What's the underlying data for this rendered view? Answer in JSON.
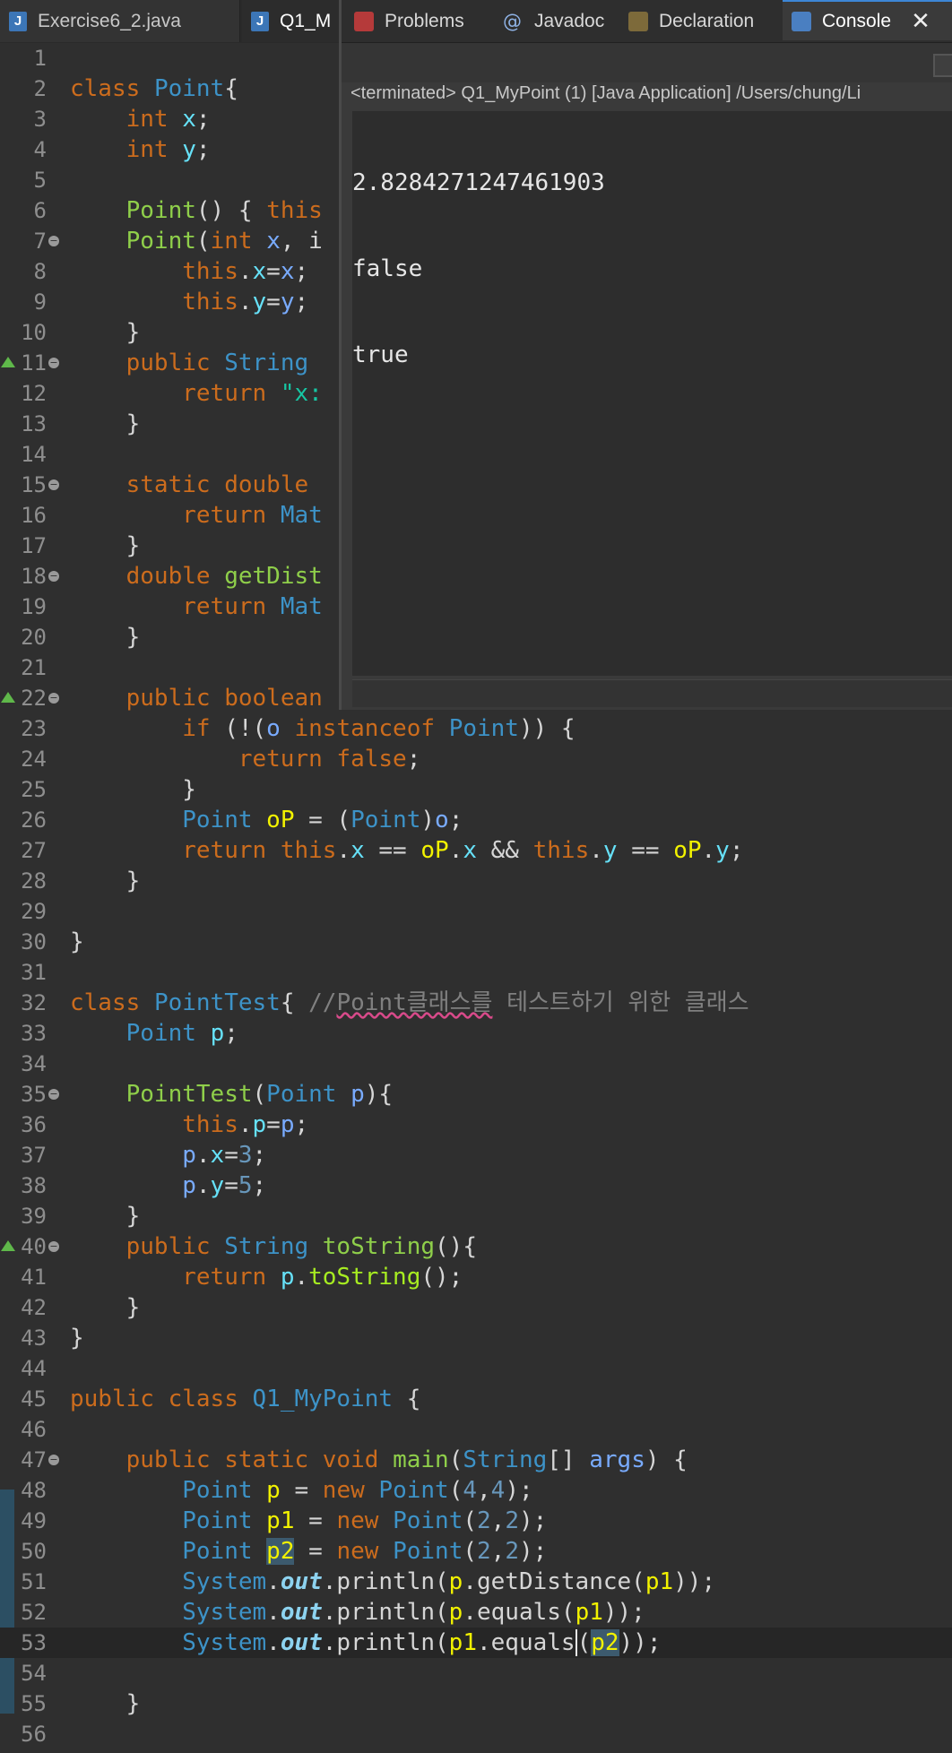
{
  "editor_tabs": [
    {
      "label": "Exercise6_2.java",
      "icon": "java-file-icon"
    },
    {
      "label": "Q1_M",
      "icon": "java-file-icon"
    }
  ],
  "console_tabs": [
    {
      "label": "Problems",
      "icon": "problems-icon"
    },
    {
      "label": "Javadoc",
      "icon": "javadoc-icon"
    },
    {
      "label": "Declaration",
      "icon": "declaration-icon"
    },
    {
      "label": "Console",
      "icon": "console-icon",
      "active": true
    }
  ],
  "console": {
    "header": "<terminated> Q1_MyPoint (1) [Java Application] /Users/chung/Li",
    "output": [
      "2.8284271247461903",
      "false",
      "true"
    ]
  },
  "line_numbers": [
    "1",
    "2",
    "3",
    "4",
    "5",
    "6",
    "7",
    "8",
    "9",
    "10",
    "11",
    "12",
    "13",
    "14",
    "15",
    "16",
    "17",
    "18",
    "19",
    "20",
    "21",
    "22",
    "23",
    "24",
    "25",
    "26",
    "27",
    "28",
    "29",
    "30",
    "31",
    "32",
    "33",
    "34",
    "35",
    "36",
    "37",
    "38",
    "39",
    "40",
    "41",
    "42",
    "43",
    "44",
    "45",
    "46",
    "47",
    "48",
    "49",
    "50",
    "51",
    "52",
    "53",
    "54",
    "55",
    "56"
  ],
  "code": {
    "l2": [
      "class",
      "Point",
      "{"
    ],
    "l3": [
      "int",
      "x",
      ";"
    ],
    "l4": [
      "int",
      "y",
      ";"
    ],
    "l6": [
      "Point",
      "() { ",
      "this"
    ],
    "l7": [
      "Point",
      "(",
      "int",
      "x",
      ", i"
    ],
    "l8": [
      "this",
      ".",
      "x",
      "=",
      "x",
      ";"
    ],
    "l9": [
      "this",
      ".",
      "y",
      "=",
      "y",
      ";"
    ],
    "l10": [
      "}"
    ],
    "l11": [
      "public",
      "String"
    ],
    "l12": [
      "return",
      "\"x:"
    ],
    "l13": [
      "}"
    ],
    "l15": [
      "static",
      "double"
    ],
    "l16": [
      "return",
      "Mat"
    ],
    "l17": [
      "}"
    ],
    "l18": [
      "double",
      "getDist"
    ],
    "l19": [
      "return",
      "Mat"
    ],
    "l20": [
      "}"
    ],
    "l22": [
      "public",
      "boolean"
    ],
    "l23": [
      "if",
      " (!(",
      "o",
      "instanceof",
      "Point",
      ")) {"
    ],
    "l24": [
      "return",
      "false",
      ";"
    ],
    "l25": [
      "}"
    ],
    "l26": [
      "Point",
      "oP",
      " = (",
      "Point",
      ")",
      "o",
      ";"
    ],
    "l27": [
      "return",
      "this",
      ".",
      "x",
      " == ",
      "oP",
      ".",
      "x",
      " && ",
      "this",
      ".",
      "y",
      " == ",
      "oP",
      ".",
      "y",
      ";"
    ],
    "l28": [
      "}"
    ],
    "l30": [
      "}"
    ],
    "l32": [
      "class",
      "PointTest",
      "{ ",
      "//",
      "Point",
      "클래스를",
      " 테스트하기 위한 클래스"
    ],
    "l33": [
      "Point",
      "p",
      ";"
    ],
    "l35": [
      "PointTest",
      "(",
      "Point",
      "p",
      "){"
    ],
    "l36": [
      "this",
      ".",
      "p",
      "=",
      "p",
      ";"
    ],
    "l37": [
      "p",
      ".",
      "x",
      "=",
      "3",
      ";"
    ],
    "l38": [
      "p",
      ".",
      "y",
      "=",
      "5",
      ";"
    ],
    "l39": [
      "}"
    ],
    "l40": [
      "public",
      "String",
      "toString",
      "(){"
    ],
    "l41": [
      "return",
      "p",
      ".",
      "toString",
      "();"
    ],
    "l42": [
      "}"
    ],
    "l43": [
      "}"
    ],
    "l45": [
      "public",
      "class",
      "Q1_MyPoint",
      " {"
    ],
    "l47": [
      "public",
      "static",
      "void",
      "main",
      "(",
      "String",
      "[] ",
      "args",
      ") {"
    ],
    "l48": [
      "Point",
      "p",
      " = ",
      "new",
      "Point",
      "(",
      "4",
      ",",
      "4",
      ");"
    ],
    "l49": [
      "Point",
      "p1",
      " = ",
      "new",
      "Point",
      "(",
      "2",
      ",",
      "2",
      ");"
    ],
    "l50": [
      "Point",
      "p2",
      " = ",
      "new",
      "Point",
      "(",
      "2",
      ",",
      "2",
      ");"
    ],
    "l51": [
      "System",
      ".",
      "out",
      ".println(",
      "p",
      ".getDistance(",
      "p1",
      "));"
    ],
    "l52": [
      "System",
      ".",
      "out",
      ".println(",
      "p",
      ".equals(",
      "p1",
      "));"
    ],
    "l53": [
      "System",
      ".",
      "out",
      ".println(",
      "p1",
      ".equals",
      "(",
      "p2",
      "));"
    ],
    "l55": [
      "}"
    ]
  },
  "colors": {
    "background": "#2f2f2f",
    "keyword": "#cc6c1d",
    "class": "#3d93c8",
    "method": "#8fcf4a",
    "field": "#66e1f8",
    "local": "#f2f200",
    "number": "#6897bb",
    "comment": "#808080",
    "accent": "#3d86d6"
  }
}
